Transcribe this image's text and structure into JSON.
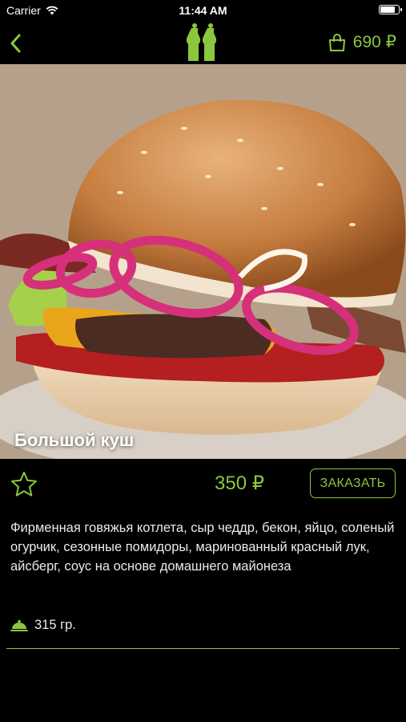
{
  "status_bar": {
    "carrier": "Carrier",
    "time": "11:44 AM"
  },
  "nav": {
    "back_icon": "chevron-left-icon",
    "logo_icon": "salt-pepper-logo",
    "cart_icon": "shopping-bag-icon",
    "cart_total": "690 ₽"
  },
  "dish": {
    "title": "Большой куш",
    "price": "350 ₽",
    "order_label": "ЗАКАЗАТЬ",
    "description": "Фирменная говяжья котлета, сыр чеддр, бекон, яйцо, соленый огурчик, сезонные помидоры, маринованный красный лук, айсберг, соус на основе домашнего майонеза",
    "weight": "315 гр."
  },
  "colors": {
    "accent": "#8cc63f",
    "background": "#000000",
    "text": "#eaeaea"
  }
}
